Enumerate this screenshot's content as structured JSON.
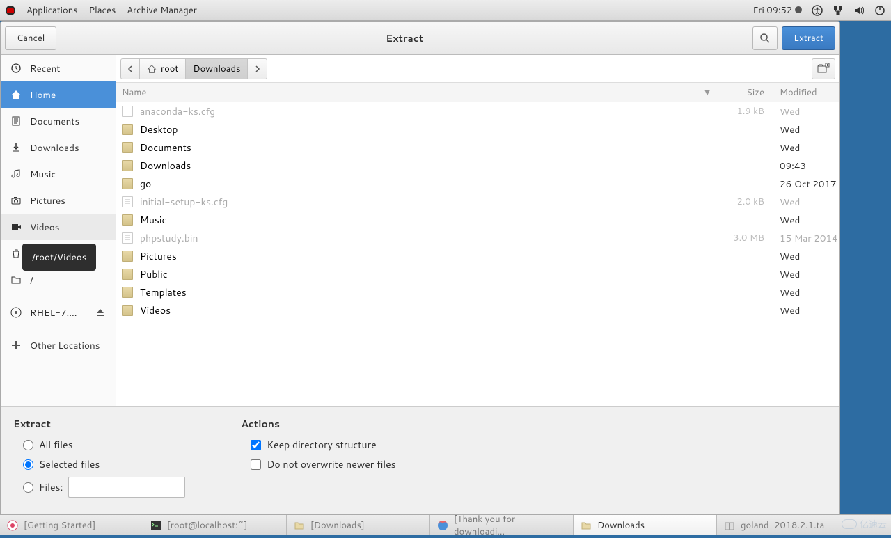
{
  "panel": {
    "apps": "Applications",
    "places": "Places",
    "appname": "Archive Manager",
    "clock": "Fri 09:52"
  },
  "dialog": {
    "cancel": "Cancel",
    "title": "Extract",
    "extract": "Extract"
  },
  "sidebar": {
    "items": [
      {
        "label": "Recent",
        "icon": "clock"
      },
      {
        "label": "Home",
        "icon": "home",
        "selected": true
      },
      {
        "label": "Documents",
        "icon": "doc"
      },
      {
        "label": "Downloads",
        "icon": "down"
      },
      {
        "label": "Music",
        "icon": "music"
      },
      {
        "label": "Pictures",
        "icon": "camera"
      },
      {
        "label": "Videos",
        "icon": "video",
        "hover": true
      },
      {
        "label": "Trash",
        "icon": "trash"
      },
      {
        "label": "/",
        "icon": "folder"
      }
    ],
    "mount": {
      "label": "RHEL-7....",
      "icon": "disc",
      "eject": true
    },
    "other": "Other Locations"
  },
  "tooltip": "/root/Videos",
  "pathbar": {
    "root": "root",
    "downloads": "Downloads"
  },
  "columns": {
    "name": "Name",
    "size": "Size",
    "modified": "Modified"
  },
  "files": [
    {
      "name": "anaconda-ks.cfg",
      "type": "file",
      "size": "1.9 kB",
      "mod": "Wed",
      "dim": true
    },
    {
      "name": "Desktop",
      "type": "folder",
      "size": "",
      "mod": "Wed"
    },
    {
      "name": "Documents",
      "type": "folder",
      "size": "",
      "mod": "Wed"
    },
    {
      "name": "Downloads",
      "type": "folder",
      "size": "",
      "mod": "09:43"
    },
    {
      "name": "go",
      "type": "folder",
      "size": "",
      "mod": "26 Oct 2017"
    },
    {
      "name": "initial-setup-ks.cfg",
      "type": "file",
      "size": "2.0 kB",
      "mod": "Wed",
      "dim": true
    },
    {
      "name": "Music",
      "type": "folder",
      "size": "",
      "mod": "Wed"
    },
    {
      "name": "phpstudy.bin",
      "type": "file",
      "size": "3.0 MB",
      "mod": "15 Mar 2014",
      "dim": true
    },
    {
      "name": "Pictures",
      "type": "folder",
      "size": "",
      "mod": "Wed"
    },
    {
      "name": "Public",
      "type": "folder",
      "size": "",
      "mod": "Wed"
    },
    {
      "name": "Templates",
      "type": "folder",
      "size": "",
      "mod": "Wed"
    },
    {
      "name": "Videos",
      "type": "folder",
      "size": "",
      "mod": "Wed"
    }
  ],
  "options": {
    "extract_h": "Extract",
    "all": "All files",
    "selected": "Selected files",
    "files": "Files:",
    "actions_h": "Actions",
    "keep": "Keep directory structure",
    "noover": "Do not overwrite newer files"
  },
  "taskbar": [
    {
      "label": "[Getting Started]",
      "icon": "help"
    },
    {
      "label": "[root@localhost:~]",
      "icon": "term"
    },
    {
      "label": "[Downloads]",
      "icon": "folder"
    },
    {
      "label": "[Thank you for downloadi...",
      "icon": "firefox"
    },
    {
      "label": "Downloads",
      "icon": "folder",
      "active": true
    },
    {
      "label": "goland-2018.2.1.ta",
      "icon": "archive"
    }
  ],
  "watermark": "亿速云"
}
